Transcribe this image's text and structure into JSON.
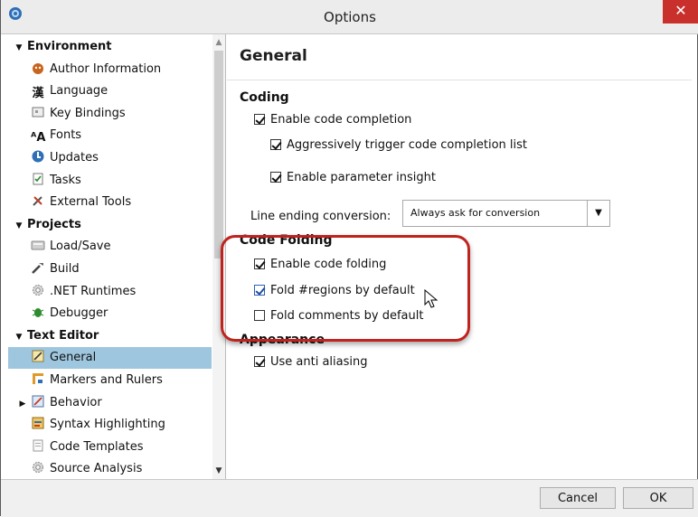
{
  "window": {
    "title": "Options",
    "close_label": "✕"
  },
  "sidebar": {
    "items": [
      {
        "label": "Environment",
        "kind": "category",
        "expanded": true,
        "icon": ""
      },
      {
        "label": "Author Information",
        "kind": "item",
        "icon": "author-icon"
      },
      {
        "label": "Language",
        "kind": "item",
        "icon": "language-icon",
        "glyph": "漢"
      },
      {
        "label": "Key Bindings",
        "kind": "item",
        "icon": "key-bindings-icon"
      },
      {
        "label": "Fonts",
        "kind": "item",
        "icon": "fonts-icon",
        "glyph": "ᴬA"
      },
      {
        "label": "Updates",
        "kind": "item",
        "icon": "updates-icon"
      },
      {
        "label": "Tasks",
        "kind": "item",
        "icon": "tasks-icon"
      },
      {
        "label": "External Tools",
        "kind": "item",
        "icon": "external-tools-icon"
      },
      {
        "label": "Projects",
        "kind": "category",
        "expanded": true,
        "icon": ""
      },
      {
        "label": "Load/Save",
        "kind": "item",
        "icon": "load-save-icon"
      },
      {
        "label": "Build",
        "kind": "item",
        "icon": "build-icon"
      },
      {
        "label": ".NET Runtimes",
        "kind": "item",
        "icon": "gear-icon"
      },
      {
        "label": "Debugger",
        "kind": "item",
        "icon": "debugger-icon"
      },
      {
        "label": "Text Editor",
        "kind": "category",
        "expanded": true,
        "icon": ""
      },
      {
        "label": "General",
        "kind": "item",
        "icon": "general-icon",
        "selected": true
      },
      {
        "label": "Markers and Rulers",
        "kind": "item",
        "icon": "markers-icon"
      },
      {
        "label": "Behavior",
        "kind": "item",
        "icon": "behavior-icon",
        "collapsed": true
      },
      {
        "label": "Syntax Highlighting",
        "kind": "item",
        "icon": "syntax-icon"
      },
      {
        "label": "Code Templates",
        "kind": "item",
        "icon": "templates-icon"
      },
      {
        "label": "Source Analysis",
        "kind": "item",
        "icon": "gear-icon"
      }
    ]
  },
  "main": {
    "title": "General",
    "coding": {
      "title": "Coding",
      "enable_code_completion": {
        "label": "Enable code completion",
        "checked": true
      },
      "aggressive_trigger": {
        "label": "Aggressively trigger code completion list",
        "checked": true
      },
      "parameter_insight": {
        "label": "Enable parameter insight",
        "checked": true
      },
      "line_ending": {
        "label": "Line ending conversion:",
        "value": "Always ask for conversion"
      }
    },
    "code_folding": {
      "title": "Code Folding",
      "enable_code_folding": {
        "label": "Enable code folding",
        "checked": true
      },
      "fold_regions": {
        "label": "Fold #regions by default",
        "checked": true
      },
      "fold_comments": {
        "label": "Fold comments by default",
        "checked": false
      }
    },
    "appearance": {
      "title": "Appearance",
      "anti_aliasing": {
        "label": "Use anti aliasing",
        "checked": true
      }
    }
  },
  "footer": {
    "cancel_label": "Cancel",
    "ok_label": "OK"
  },
  "colors": {
    "selection": "#9fc6df",
    "highlight_ring": "#c0231d",
    "close_button": "#c9302c"
  }
}
